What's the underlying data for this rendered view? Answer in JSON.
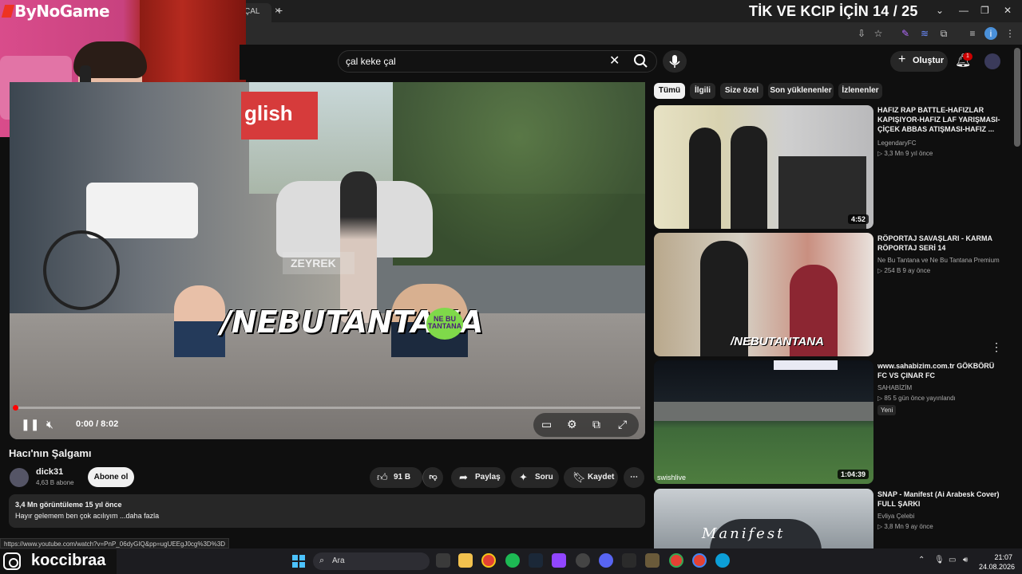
{
  "browser": {
    "tab_label": "ÇAL",
    "tab_close": "×",
    "new_tab": "+",
    "window_controls": [
      "⌄",
      "—",
      "❐",
      "✕"
    ]
  },
  "overlay": {
    "title": "TİK VE KCIP İÇİN 14 / 25",
    "brand": "ByNoGame",
    "instagram_handle": "koccibraa"
  },
  "header": {
    "search_value": "çal keke çal",
    "create_label": "Oluştur",
    "notification_count": "1"
  },
  "player": {
    "time": "0:00 / 8:02",
    "watermark": "ZEYREK",
    "banner": "/NEBUTANTANA",
    "badge": "NE BU TANTANA",
    "progress_fraction": 0.0
  },
  "video": {
    "title": "Hacı'nın Şalgamı",
    "channel": "dick31",
    "subscribers": "4,63 B abone",
    "subscribe_label": "Abone ol",
    "likes": "91 B",
    "share_label": "Paylaş",
    "ask_label": "Soru",
    "save_label": "Kaydet",
    "more_label": "⋯",
    "views_line": "3,4 Mn görüntüleme  15 yıl önce",
    "description": "Hayır gelemem ben çok acılıyım ...daha fazla"
  },
  "status_url": "https://www.youtube.com/watch?v=PnP_06dyGIQ&pp=ugUEEgJ0cg%3D%3D",
  "chips": [
    "Tümü",
    "İlgili",
    "Size özel",
    "Son yüklenenler",
    "İzlenenler"
  ],
  "recommendations": [
    {
      "title": "HAFIZ RAP BATTLE-HAFIZLAR KAPIŞIYOR-HAFIZ LAF YARIŞMASI-ÇİÇEK ABBAS ATIŞMASI-HAFIZ ...",
      "channel": "LegendaryFC",
      "meta": "▷ 3,3 Mn   9 yıl önce",
      "duration": "4:52"
    },
    {
      "title": "RÖPORTAJ SAVAŞLARI - KARMA RÖPORTAJ SERİ 14",
      "channel": "Ne Bu Tantana ve Ne Bu Tantana Premium",
      "meta": "▷ 254 B   9 ay önce",
      "duration": "",
      "thumb_text": "/NEBUTANTANA"
    },
    {
      "title": "www.sahabizim.com.tr GÖKBÖRÜ FC VS ÇINAR FC",
      "channel": "SAHABİZİM",
      "meta": "▷ 85   5 gün önce yayınlandı",
      "badge": "Yeni",
      "duration": "1:04:39",
      "thumb_text": "swishlive"
    },
    {
      "title": "SNAP - Manifest (Ai Arabesk Cover) FULL ŞARKI",
      "channel": "Evliya Çelebi",
      "meta": "▷ 3,8 Mn   9 ay önce",
      "duration": "",
      "thumb_text": "Manifest"
    }
  ],
  "taskbar": {
    "search_label": "Ara",
    "time": "21:07",
    "date": "24.08.2026"
  },
  "colors": {
    "accent_red": "#ff0000",
    "background": "#0f0f0f",
    "chip_bg": "#272727"
  }
}
